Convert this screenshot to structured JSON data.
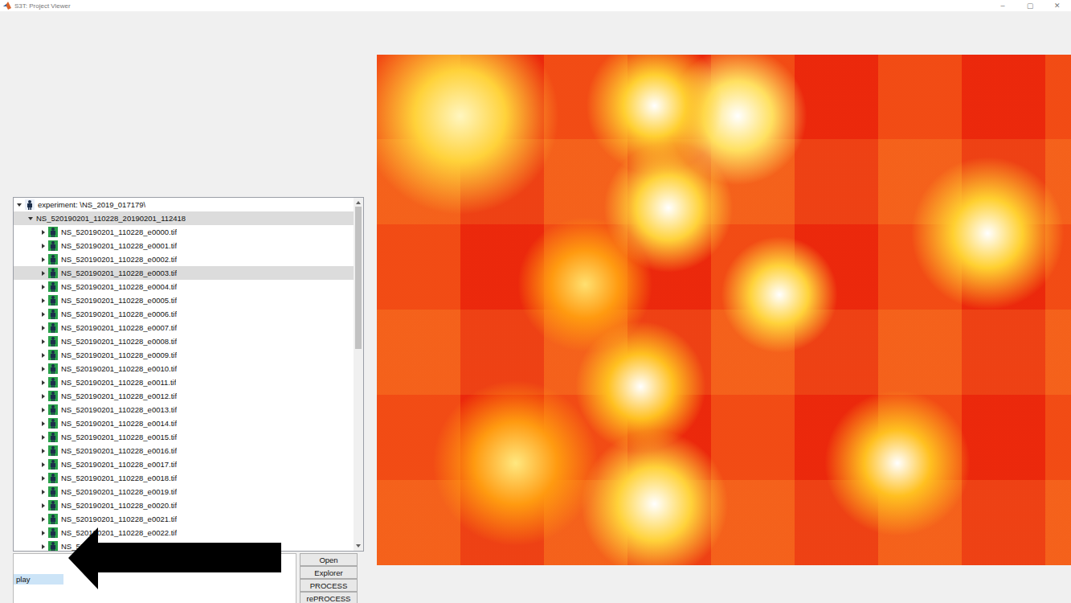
{
  "window": {
    "title": "S3T: Project Viewer",
    "controls": [
      "–",
      "▢",
      "✕"
    ]
  },
  "tree": {
    "items": [
      {
        "label": "experiment: \\NS_2019_017179\\",
        "kind": "experiment",
        "expanded": true,
        "selected": false
      },
      {
        "label": "NS_520190201_110228_20190201_112418",
        "kind": "folder",
        "expanded": true,
        "selected": true
      },
      {
        "label": "NS_520190201_110228_e0000.tif",
        "kind": "file",
        "expanded": false,
        "selected": false
      },
      {
        "label": "NS_520190201_110228_e0001.tif",
        "kind": "file",
        "expanded": false,
        "selected": false
      },
      {
        "label": "NS_520190201_110228_e0002.tif",
        "kind": "file",
        "expanded": false,
        "selected": false
      },
      {
        "label": "NS_520190201_110228_e0003.tif",
        "kind": "file",
        "expanded": false,
        "selected": true
      },
      {
        "label": "NS_520190201_110228_e0004.tif",
        "kind": "file",
        "expanded": false,
        "selected": false
      },
      {
        "label": "NS_520190201_110228_e0005.tif",
        "kind": "file",
        "expanded": false,
        "selected": false
      },
      {
        "label": "NS_520190201_110228_e0006.tif",
        "kind": "file",
        "expanded": false,
        "selected": false
      },
      {
        "label": "NS_520190201_110228_e0007.tif",
        "kind": "file",
        "expanded": false,
        "selected": false
      },
      {
        "label": "NS_520190201_110228_e0008.tif",
        "kind": "file",
        "expanded": false,
        "selected": false
      },
      {
        "label": "NS_520190201_110228_e0009.tif",
        "kind": "file",
        "expanded": false,
        "selected": false
      },
      {
        "label": "NS_520190201_110228_e0010.tif",
        "kind": "file",
        "expanded": false,
        "selected": false
      },
      {
        "label": "NS_520190201_110228_e0011.tif",
        "kind": "file",
        "expanded": false,
        "selected": false
      },
      {
        "label": "NS_520190201_110228_e0012.tif",
        "kind": "file",
        "expanded": false,
        "selected": false
      },
      {
        "label": "NS_520190201_110228_e0013.tif",
        "kind": "file",
        "expanded": false,
        "selected": false
      },
      {
        "label": "NS_520190201_110228_e0014.tif",
        "kind": "file",
        "expanded": false,
        "selected": false
      },
      {
        "label": "NS_520190201_110228_e0015.tif",
        "kind": "file",
        "expanded": false,
        "selected": false
      },
      {
        "label": "NS_520190201_110228_e0016.tif",
        "kind": "file",
        "expanded": false,
        "selected": false
      },
      {
        "label": "NS_520190201_110228_e0017.tif",
        "kind": "file",
        "expanded": false,
        "selected": false
      },
      {
        "label": "NS_520190201_110228_e0018.tif",
        "kind": "file",
        "expanded": false,
        "selected": false
      },
      {
        "label": "NS_520190201_110228_e0019.tif",
        "kind": "file",
        "expanded": false,
        "selected": false
      },
      {
        "label": "NS_520190201_110228_e0020.tif",
        "kind": "file",
        "expanded": false,
        "selected": false
      },
      {
        "label": "NS_520190201_110228_e0021.tif",
        "kind": "file",
        "expanded": false,
        "selected": false
      },
      {
        "label": "NS_520190201_110228_e0022.tif",
        "kind": "file",
        "expanded": false,
        "selected": false
      },
      {
        "label": "NS_520190201_110228_e0023.tif",
        "kind": "file",
        "expanded": false,
        "selected": false
      }
    ]
  },
  "command": {
    "value": "play",
    "selected": true
  },
  "buttons": [
    "Open",
    "Explorer",
    "PROCESS",
    "rePROCESS"
  ]
}
